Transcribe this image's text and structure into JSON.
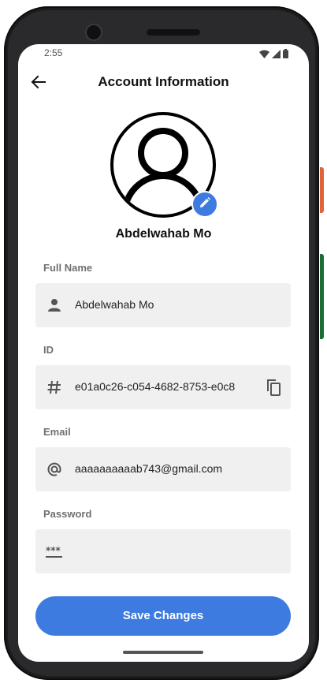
{
  "status_bar": {
    "time": "2:55",
    "icons": [
      "wifi-icon",
      "signal-icon",
      "battery-icon"
    ]
  },
  "app_bar": {
    "title": "Account Information",
    "back_icon": "arrow-back-icon"
  },
  "profile": {
    "name": "Abdelwahab Mo",
    "avatar_icon": "person-icon",
    "edit_icon": "pencil-icon"
  },
  "fields": {
    "full_name": {
      "label": "Full Name",
      "value": "Abdelwahab Mo",
      "icon": "person-icon"
    },
    "id": {
      "label": "ID",
      "value": "e01a0c26-c054-4682-8753-e0c8",
      "icon": "hash-icon",
      "action_icon": "copy-icon"
    },
    "email": {
      "label": "Email",
      "value": "aaaaaaaaaab743@gmail.com",
      "icon": "at-sign-icon"
    },
    "password": {
      "label": "Password",
      "value": "",
      "icon": "password-icon"
    }
  },
  "actions": {
    "save_label": "Save Changes"
  },
  "colors": {
    "accent": "#3d7be0",
    "field_bg": "#f0f0f0",
    "label": "#707070"
  }
}
